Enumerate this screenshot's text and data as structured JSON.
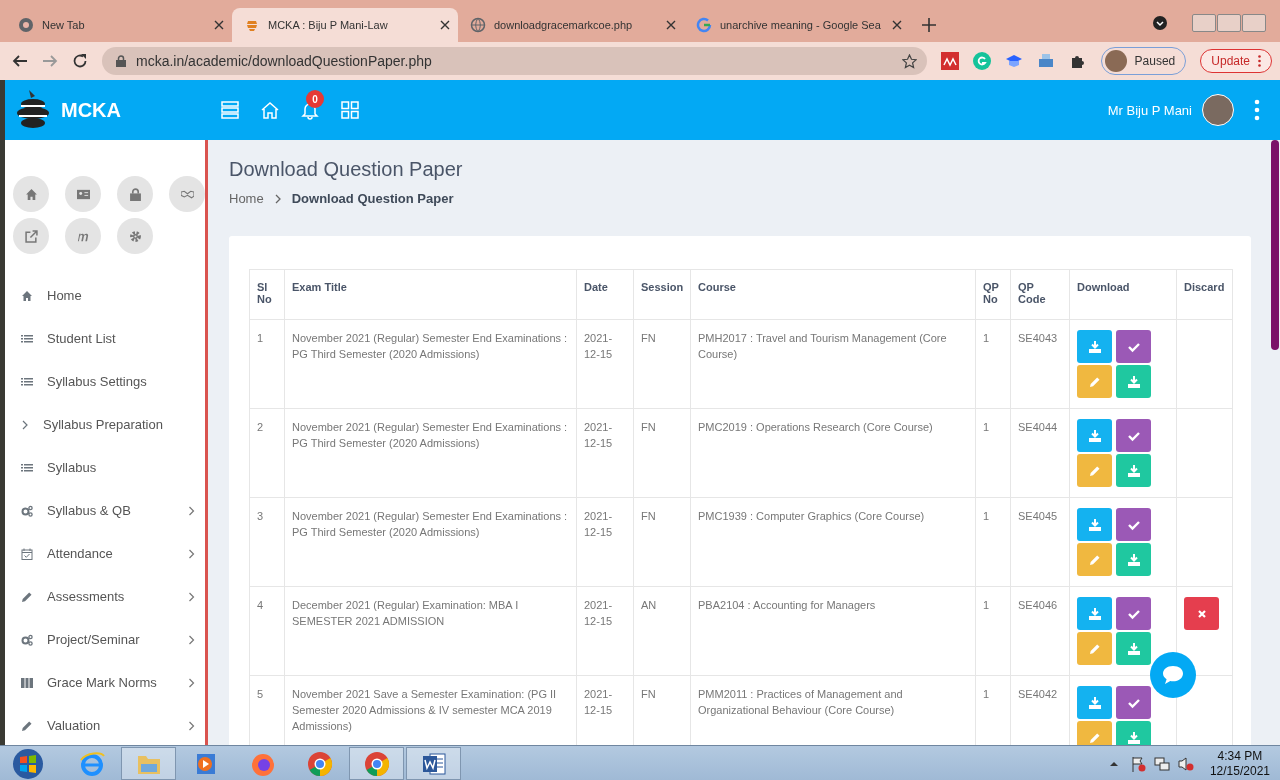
{
  "browser": {
    "tabs": [
      {
        "title": "New Tab",
        "kind": "chrome",
        "selected": false
      },
      {
        "title": "MCKA : Biju P Mani-Law",
        "kind": "logo",
        "selected": true
      },
      {
        "title": "downloadgracemarkcoe.php",
        "kind": "globe",
        "selected": false
      },
      {
        "title": "unarchive meaning - Google Sea",
        "kind": "google",
        "selected": false
      }
    ],
    "address": "mcka.in/academic/downloadQuestionPaper.php",
    "profile": "Paused",
    "update": "Update"
  },
  "header": {
    "brand": "MCKA",
    "notifications": "0",
    "user": "Mr Biju P Mani"
  },
  "sidebar": {
    "items": [
      {
        "label": "Home",
        "kind": "home",
        "submenu": false
      },
      {
        "label": "Student List",
        "kind": "list",
        "submenu": false
      },
      {
        "label": "Syllabus Settings",
        "kind": "list",
        "submenu": false
      },
      {
        "label": "Syllabus Preparation",
        "kind": "chevron",
        "submenu": false
      },
      {
        "label": "Syllabus",
        "kind": "list",
        "submenu": false
      },
      {
        "label": "Syllabus & QB",
        "kind": "gears",
        "submenu": true
      },
      {
        "label": "Attendance",
        "kind": "calendar",
        "submenu": true
      },
      {
        "label": "Assessments",
        "kind": "pencil",
        "submenu": true
      },
      {
        "label": "Project/Seminar",
        "kind": "gears",
        "submenu": true
      },
      {
        "label": "Grace Mark Norms",
        "kind": "columns",
        "submenu": true
      },
      {
        "label": "Valuation",
        "kind": "pencil",
        "submenu": true
      }
    ]
  },
  "page": {
    "title": "Download Question Paper",
    "breadcrumb": [
      "Home",
      "Download Question Paper"
    ]
  },
  "table": {
    "columns": [
      "Sl No",
      "Exam Title",
      "Date",
      "Session",
      "Course",
      "QP No",
      "QP Code",
      "Download",
      "Discard"
    ],
    "rows": [
      {
        "sl": "1",
        "exam": "November 2021 (Regular) Semester End Examinations : PG Third Semester (2020 Admissions)",
        "date": "2021-12-15",
        "session": "FN",
        "course": "PMH2017 : Travel and Tourism Management (Core Course)",
        "qp_no": "1",
        "qp_code": "SE4043",
        "discard": false
      },
      {
        "sl": "2",
        "exam": "November 2021 (Regular) Semester End Examinations : PG Third Semester (2020 Admissions)",
        "date": "2021-12-15",
        "session": "FN",
        "course": "PMC2019 : Operations Research (Core Course)",
        "qp_no": "1",
        "qp_code": "SE4044",
        "discard": false
      },
      {
        "sl": "3",
        "exam": "November 2021 (Regular) Semester End Examinations : PG Third Semester (2020 Admissions)",
        "date": "2021-12-15",
        "session": "FN",
        "course": "PMC1939 : Computer Graphics (Core Course)",
        "qp_no": "1",
        "qp_code": "SE4045",
        "discard": false
      },
      {
        "sl": "4",
        "exam": "December 2021 (Regular) Examination: MBA I SEMESTER 2021 ADMISSION",
        "date": "2021-12-15",
        "session": "AN",
        "course": "PBA2104 : Accounting for Managers",
        "qp_no": "1",
        "qp_code": "SE4046",
        "discard": true
      },
      {
        "sl": "5",
        "exam": "November 2021 Save a Semester Examination: (PG II Semester 2020 Admissions & IV semester MCA 2019 Admissions)",
        "date": "2021-12-15",
        "session": "FN",
        "course": "PMM2011 : Practices of Management and Organizational Behaviour (Core Course)",
        "qp_no": "1",
        "qp_code": "SE4042",
        "discard": false
      }
    ]
  },
  "taskbar": {
    "apps": [
      {
        "kind": "ie",
        "selected": false
      },
      {
        "kind": "folder",
        "selected": true
      },
      {
        "kind": "player",
        "selected": false
      },
      {
        "kind": "firefox",
        "selected": false
      },
      {
        "kind": "chrome",
        "selected": false
      },
      {
        "kind": "chrome",
        "selected": true
      },
      {
        "kind": "word",
        "selected": true
      }
    ],
    "time": "4:34 PM",
    "date": "12/15/2021"
  }
}
